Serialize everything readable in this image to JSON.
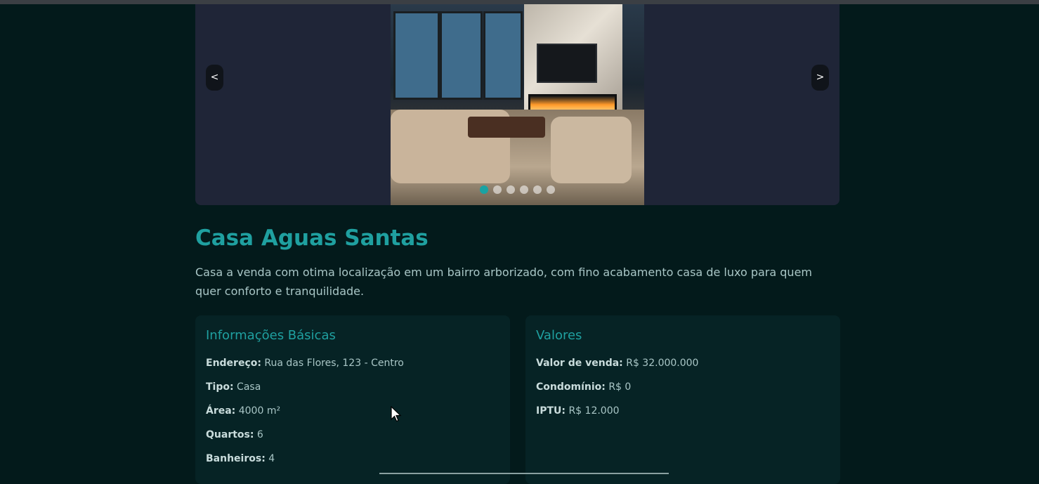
{
  "carousel": {
    "prev_label": "<",
    "next_label": ">",
    "dot_count": 6,
    "active_index": 0
  },
  "property": {
    "title": "Casa Aguas Santas",
    "description": "Casa a venda com otima localização em um bairro arborizado, com fino acabamento casa de luxo para quem quer conforto e tranquilidade."
  },
  "basic_info": {
    "heading": "Informações Básicas",
    "rows": [
      {
        "label": "Endereço:",
        "value": "Rua das Flores, 123 - Centro"
      },
      {
        "label": "Tipo:",
        "value": "Casa"
      },
      {
        "label": "Área:",
        "value": "4000 m²"
      },
      {
        "label": "Quartos:",
        "value": "6"
      },
      {
        "label": "Banheiros:",
        "value": "4"
      }
    ]
  },
  "values": {
    "heading": "Valores",
    "rows": [
      {
        "label": "Valor de venda:",
        "value": "R$ 32.000.000"
      },
      {
        "label": "Condomínio:",
        "value": "R$ 0"
      },
      {
        "label": "IPTU:",
        "value": "R$ 12.000"
      }
    ]
  },
  "colors": {
    "accent": "#1fa0a0",
    "background": "#031a1b",
    "card": "#062325",
    "carousel_bg": "#1f2537"
  }
}
